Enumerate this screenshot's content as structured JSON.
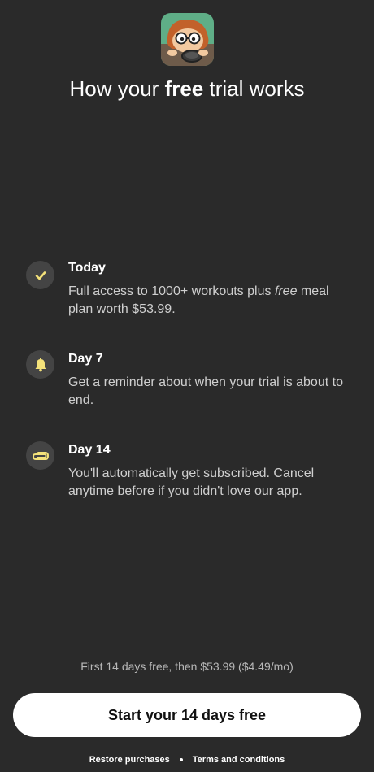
{
  "header": {
    "app_icon": "app-mascot-icon",
    "title_pre": "How your ",
    "title_bold": "free",
    "title_post": " trial works"
  },
  "steps": [
    {
      "icon": "check-icon",
      "title": "Today",
      "desc_pre": "Full access to 1000+ workouts plus ",
      "desc_em": "free",
      "desc_post": " meal plan worth $53.99."
    },
    {
      "icon": "bell-icon",
      "title": "Day 7",
      "desc": "Get a reminder about when your trial is about to end."
    },
    {
      "icon": "paperclip-icon",
      "title": "Day 14",
      "desc": "You'll automatically get subscribed. Cancel anytime before if you didn't love our app."
    }
  ],
  "pricing_note": "First 14 days free, then $53.99 ($4.49/mo)",
  "cta_label": "Start your 14 days free",
  "footer": {
    "restore": "Restore purchases",
    "terms": "Terms and conditions"
  },
  "colors": {
    "background": "#2a2a2a",
    "icon_circle": "#444444",
    "icon_accent": "#f4e27a",
    "cta_bg": "#ffffff",
    "cta_text": "#111111"
  }
}
